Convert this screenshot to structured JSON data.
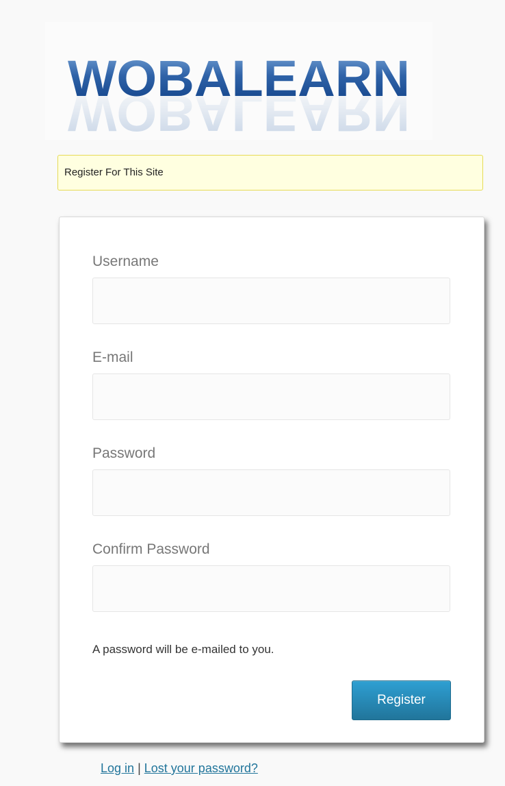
{
  "logo": {
    "text": "WOBALEARN"
  },
  "notice": {
    "text": "Register For This Site"
  },
  "form": {
    "username_label": "Username",
    "username_value": "",
    "email_label": "E-mail",
    "email_value": "",
    "password_label": "Password",
    "password_value": "",
    "confirm_label": "Confirm Password",
    "confirm_value": "",
    "hint": "A password will be e-mailed to you.",
    "register_label": "Register"
  },
  "nav": {
    "login_label": "Log in",
    "separator": "|",
    "lost_password_label": "Lost your password?"
  },
  "colors": {
    "accent": "#21759b",
    "notice_bg": "#ffffe0",
    "notice_border": "#e6db55"
  }
}
